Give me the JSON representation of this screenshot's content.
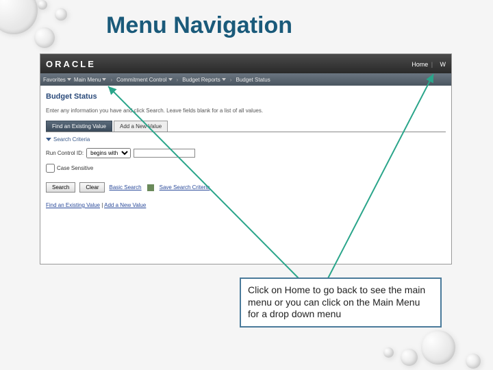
{
  "slide": {
    "title": "Menu Navigation"
  },
  "app": {
    "logo": "ORACLE",
    "header_links": {
      "home": "Home",
      "worklist_initial": "W"
    },
    "breadcrumb": {
      "favorites": "Favorites",
      "main_menu": "Main Menu",
      "level1": "Commitment Control",
      "level2": "Budget Reports",
      "level3": "Budget Status"
    },
    "page": {
      "heading": "Budget Status",
      "instruction": "Enter any information you have and click Search. Leave fields blank for a list of all values.",
      "tabs": {
        "find": "Find an Existing Value",
        "add": "Add a New Value"
      },
      "search_criteria_label": "Search Criteria",
      "field": {
        "label": "Run Control ID:",
        "operator": "begins with",
        "value": ""
      },
      "case_sensitive_label": "Case Sensitive",
      "buttons": {
        "search": "Search",
        "clear": "Clear"
      },
      "links": {
        "basic_search": "Basic Search",
        "save_criteria": "Save Search Criteria",
        "find_existing": "Find an Existing Value",
        "add_new": "Add a New Value"
      }
    }
  },
  "callout": {
    "text": "Click on Home to go back to see the main menu or you can click on the Main Menu for a drop down menu"
  }
}
